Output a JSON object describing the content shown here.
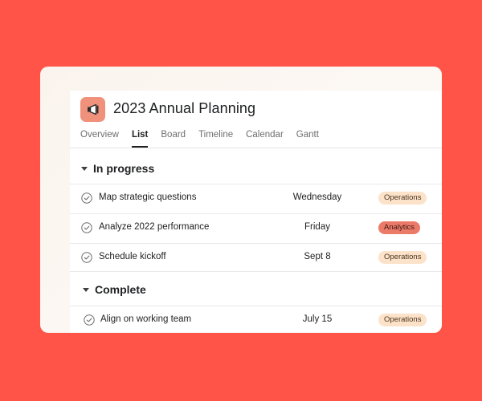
{
  "project": {
    "title": "2023 Annual Planning",
    "icon": "megaphone-icon"
  },
  "tabs": [
    {
      "label": "Overview",
      "active": false
    },
    {
      "label": "List",
      "active": true
    },
    {
      "label": "Board",
      "active": false
    },
    {
      "label": "Timeline",
      "active": false
    },
    {
      "label": "Calendar",
      "active": false
    },
    {
      "label": "Gantt",
      "active": false
    }
  ],
  "sections": [
    {
      "title": "In progress",
      "tasks": [
        {
          "name": "Map strategic questions",
          "date": "Wednesday",
          "tag": "Operations",
          "tag_type": "operations"
        },
        {
          "name": "Analyze 2022 performance",
          "date": "Friday",
          "tag": "Analytics",
          "tag_type": "analytics"
        },
        {
          "name": "Schedule kickoff",
          "date": "Sept 8",
          "tag": "Operations",
          "tag_type": "operations"
        }
      ]
    },
    {
      "title": "Complete",
      "tasks": [
        {
          "name": "Align on working team",
          "date": "July 15",
          "tag": "Operations",
          "tag_type": "operations"
        }
      ]
    }
  ],
  "colors": {
    "background": "#ff5447",
    "project_icon": "#f0917c",
    "operations_tag": "#fbe2c8",
    "analytics_tag": "#ec7a68"
  }
}
